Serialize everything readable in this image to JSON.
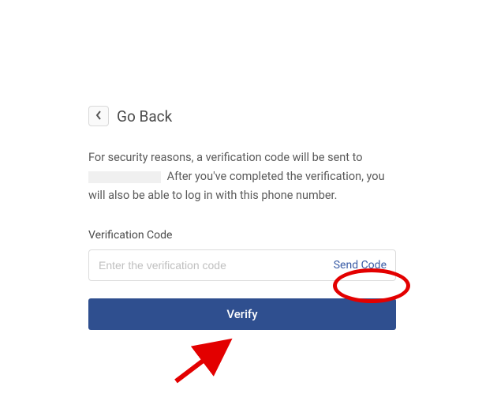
{
  "back": {
    "label": "Go Back"
  },
  "description": {
    "part1": "For security reasons, a verification code will be sent to ",
    "part2": " After you've completed the verification, you will also be able to log in with this phone number."
  },
  "field": {
    "label": "Verification Code",
    "placeholder": "Enter the verification code",
    "send_label": "Send Code"
  },
  "verify": {
    "label": "Verify"
  },
  "colors": {
    "primary": "#2f4f8f",
    "link": "#3a5ca6",
    "annotation": "#e30000"
  }
}
